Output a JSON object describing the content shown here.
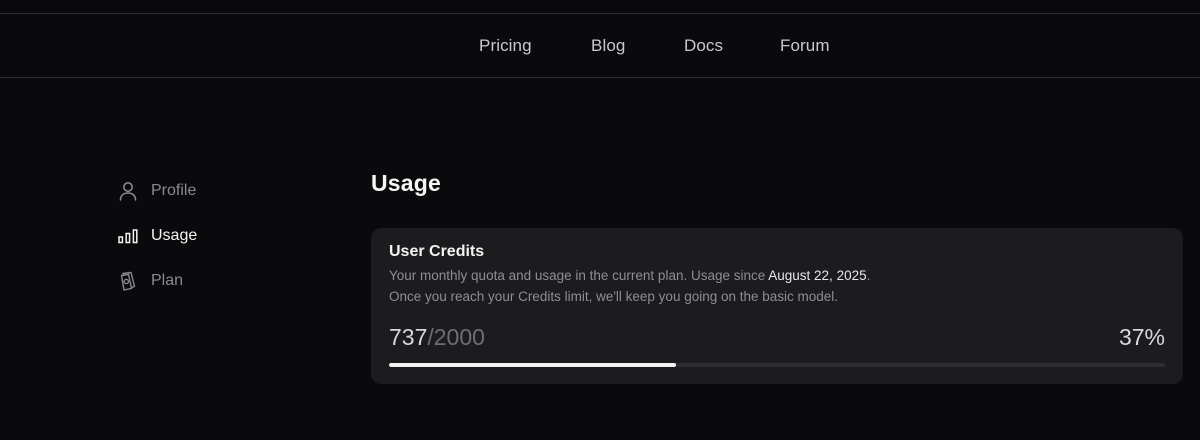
{
  "nav": {
    "items": [
      {
        "label": "Pricing"
      },
      {
        "label": "Blog"
      },
      {
        "label": "Docs"
      },
      {
        "label": "Forum"
      }
    ]
  },
  "sidebar": {
    "items": [
      {
        "label": "Profile",
        "icon": "user-icon",
        "active": false
      },
      {
        "label": "Usage",
        "icon": "bar-chart-icon",
        "active": true
      },
      {
        "label": "Plan",
        "icon": "document-badge-icon",
        "active": false
      }
    ]
  },
  "main": {
    "title": "Usage",
    "card": {
      "title": "User Credits",
      "desc_line1_prefix": "Your monthly quota and usage in the current plan. Usage since ",
      "desc_date": "August 22, 2025",
      "desc_line1_suffix": ".",
      "desc_line2": "Once you reach your Credits limit, we'll keep you going on the basic model.",
      "used": "737",
      "separator_total": "/2000",
      "percent": "37%",
      "progress_fraction": 0.37
    }
  },
  "colors": {
    "background": "#0a0a0c",
    "card": "#1c1c1f",
    "progress_fill": "#f2f2f3",
    "progress_track": "#2d2d31"
  }
}
